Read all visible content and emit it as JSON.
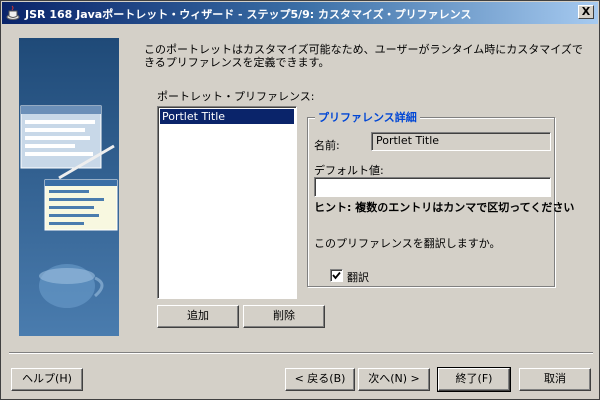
{
  "window": {
    "title": "JSR 168 Javaポートレット・ウィザード - ステップ5/9: カスタマイズ・プリファレンス",
    "close_label": "X"
  },
  "intro_text": "このポートレットはカスタマイズ可能なため、ユーザーがランタイム時にカスタマイズできるプリファレンスを定義できます。",
  "preferences": {
    "label": "ポートレット・プリファレンス:",
    "items": [
      "Portlet Title"
    ],
    "add_label": "追加",
    "delete_label": "削除"
  },
  "details": {
    "title": "プリファレンス詳細",
    "name_label": "名前:",
    "name_value": "Portlet Title",
    "default_label": "デフォルト値:",
    "default_value": "",
    "hint": "ヒント: 複数のエントリはカンマで区切ってください",
    "translate_question": "このプリファレンスを翻訳しますか。",
    "translate_label": "翻訳",
    "translate_checked": true
  },
  "footer": {
    "help_label": "ヘルプ(H)",
    "back_label": "< 戻る(B)",
    "next_label": "次へ(N) >",
    "finish_label": "終了(F)",
    "cancel_label": "取消"
  }
}
